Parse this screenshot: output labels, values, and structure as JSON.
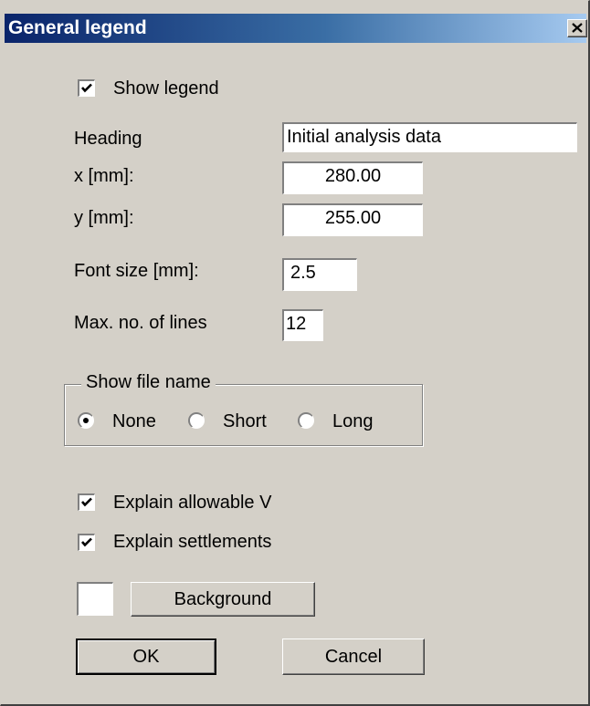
{
  "dialog": {
    "title": "General legend",
    "close_icon": "close-x-icon"
  },
  "legend": {
    "show_legend_label": "Show legend",
    "show_legend_checked": true,
    "heading_label": "Heading",
    "heading_value": "Initial analysis data",
    "x_label": "x [mm]:",
    "x_value": "280.00",
    "y_label": "y [mm]:",
    "y_value": "255.00",
    "font_size_label": "Font size [mm]:",
    "font_size_value": "2.5",
    "max_lines_label": "Max. no. of lines",
    "max_lines_value": "12"
  },
  "file_name": {
    "group_label": "Show file name",
    "options": [
      "None",
      "Short",
      "Long"
    ],
    "selected": "None"
  },
  "explain": {
    "allowable_v_label": "Explain allowable V",
    "allowable_v_checked": true,
    "settlements_label": "Explain settlements",
    "settlements_checked": true
  },
  "background": {
    "button_label": "Background",
    "swatch_color": "#ffffff"
  },
  "footer": {
    "ok_label": "OK",
    "cancel_label": "Cancel"
  }
}
